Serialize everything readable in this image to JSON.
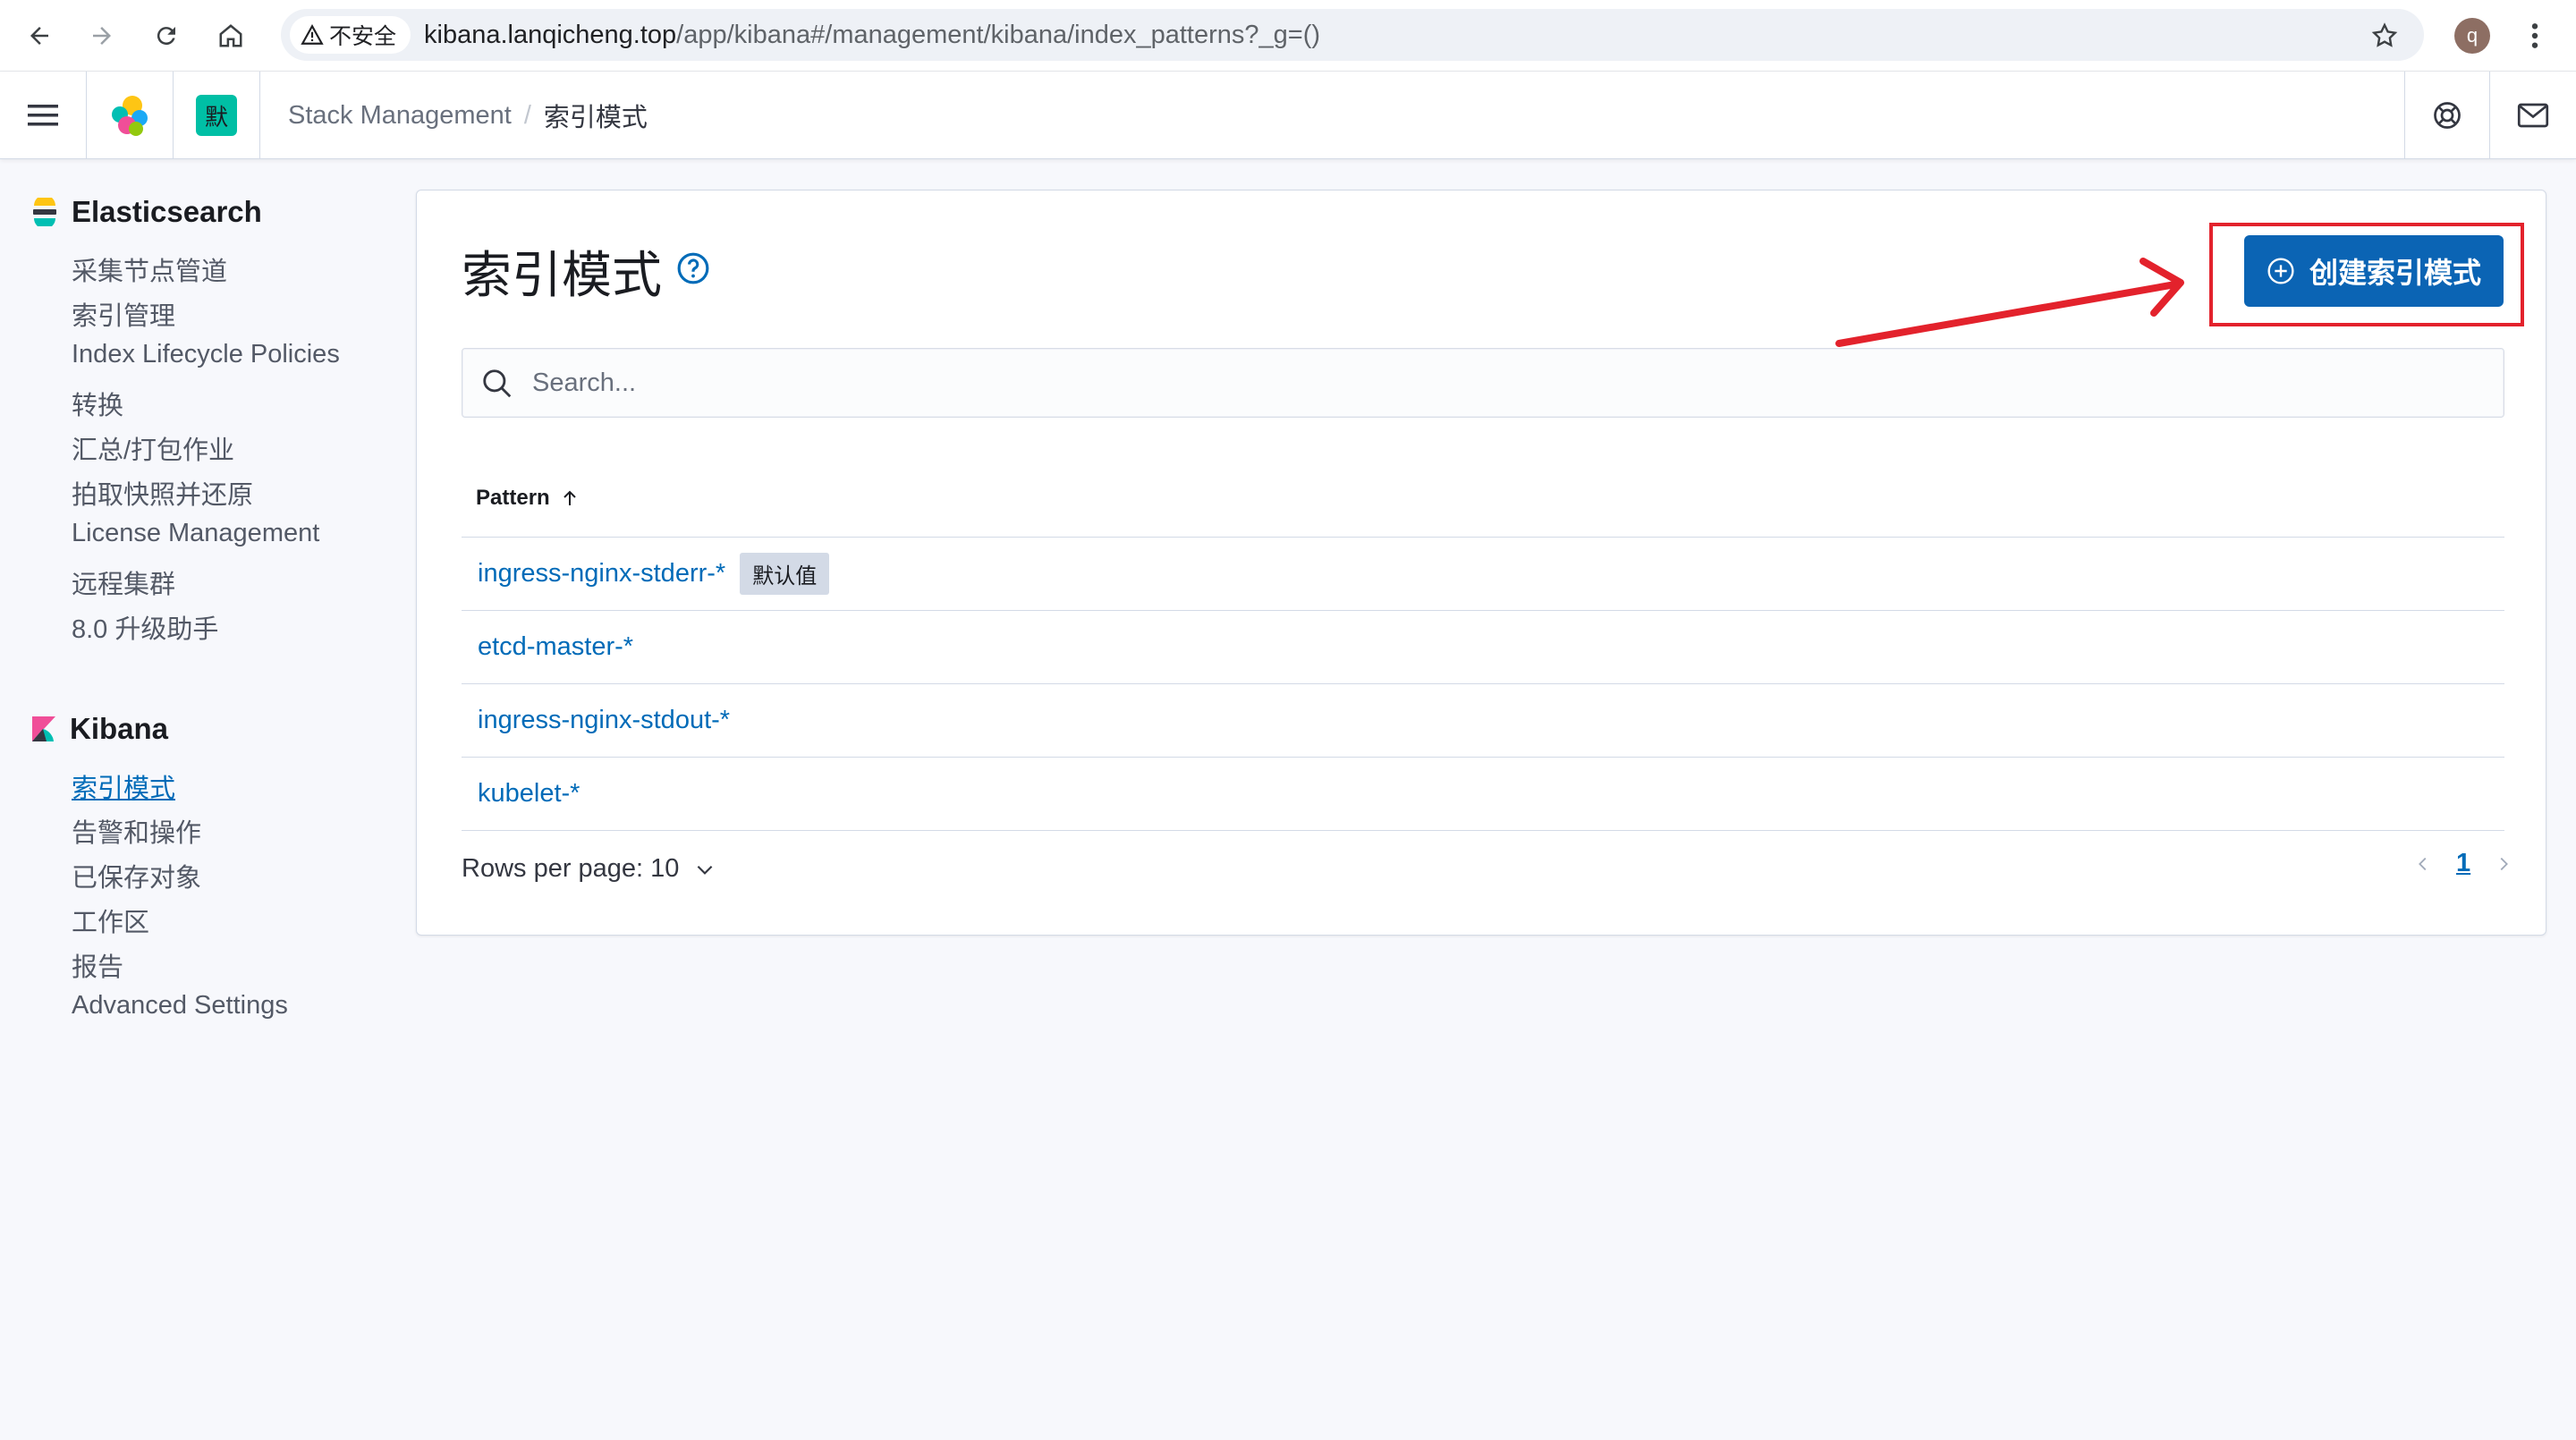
{
  "browser": {
    "security_label": "不安全",
    "url_host": "kibana.lanqicheng.top",
    "url_path": "/app/kibana#/management/kibana/index_patterns?_g=()",
    "profile_initial": "q"
  },
  "header": {
    "space_avatar": "默",
    "breadcrumb": {
      "parent": "Stack Management",
      "separator": "/",
      "current": "索引模式"
    }
  },
  "sidebar": {
    "elasticsearch": {
      "title": "Elasticsearch",
      "items": [
        "采集节点管道",
        "索引管理",
        "Index Lifecycle Policies",
        "转换",
        "汇总/打包作业",
        "拍取快照并还原",
        "License Management",
        "远程集群",
        "8.0 升级助手"
      ]
    },
    "kibana": {
      "title": "Kibana",
      "items": [
        "索引模式",
        "告警和操作",
        "已保存对象",
        "工作区",
        "报告",
        "Advanced Settings"
      ],
      "active_index": 0
    }
  },
  "main": {
    "title": "索引模式",
    "create_button": "创建索引模式",
    "search_placeholder": "Search...",
    "table": {
      "column_header": "Pattern",
      "rows": [
        {
          "name": "ingress-nginx-stderr-*",
          "badge": "默认值"
        },
        {
          "name": "etcd-master-*"
        },
        {
          "name": "ingress-nginx-stdout-*"
        },
        {
          "name": "kubelet-*"
        }
      ]
    },
    "rows_per_page": "Rows per page: 10",
    "current_page": "1"
  },
  "colors": {
    "accent": "#0b64b4",
    "link": "#006bb8",
    "annotation": "#e3222c"
  }
}
